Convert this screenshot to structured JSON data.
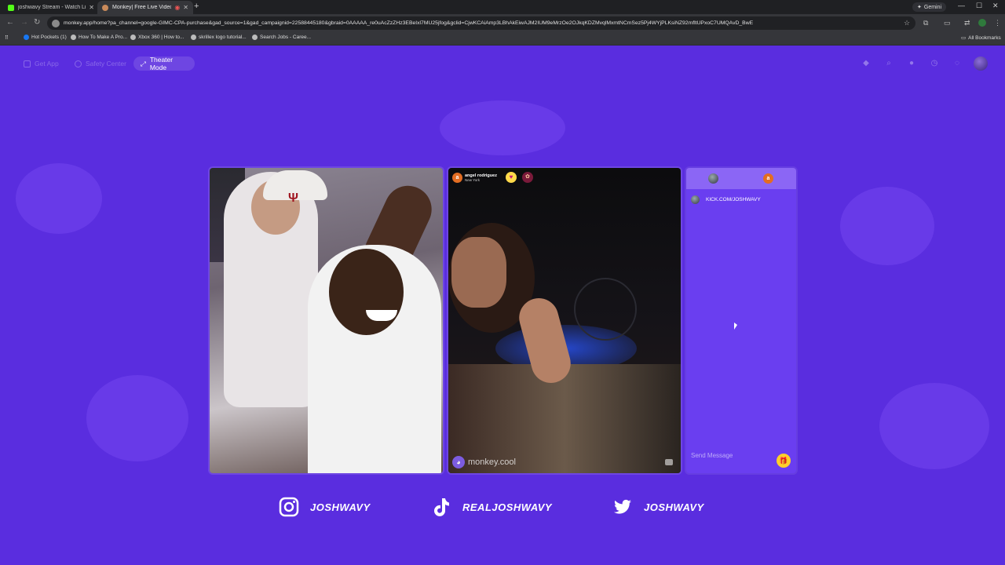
{
  "browser": {
    "tabs": [
      {
        "title": "joshwavy Stream - Watch Live o",
        "favicon_color": "#53fc18",
        "active": false
      },
      {
        "title": "Monkey| Free Live Video Cha",
        "favicon_color": "#c98a5a",
        "active": true
      }
    ],
    "gemini_label": "Gemini",
    "url": "monkey.app/home?pa_channel=google-GIMC-CPA-purchase&gad_source=1&gad_campaignid=22588445180&gbraid=0AAAAA_re0uAcZzZHz3EBeIxl7MU25jfog&gclid=CjwKCAiAmp3LBhAkEiwAJM2IUM9eMrzOe2OJkqKDZMvqlMxmtNCmSez5Pj4WYjPLKsiNZ92mfltUPxoC7UMQAvD_BwE",
    "bookmarks": [
      "Hot Pockets (1)",
      "How To Make A Pro...",
      "Xbox 360 | How to...",
      "skrillex logo tutorial...",
      "Search Jobs - Caree..."
    ],
    "all_bookmarks": "All Bookmarks"
  },
  "nav": {
    "get_app": "Get App",
    "safety_center": "Safety Center",
    "theater_mode": "Theater Mode"
  },
  "stranger": {
    "initial": "a",
    "name": "angel rodriguez",
    "location": "New York"
  },
  "watermark": "monkey.cool",
  "chat": {
    "messages": [
      {
        "text": "KICK.COM/JOSHWAVY"
      }
    ],
    "input_placeholder": "Send Message"
  },
  "socials": [
    {
      "platform": "instagram",
      "handle": "JOSHWAVY"
    },
    {
      "platform": "tiktok",
      "handle": "REALJOSHWAVY"
    },
    {
      "platform": "twitter",
      "handle": "JOSHWAVY"
    }
  ],
  "colors": {
    "page_bg": "#5a2ddf",
    "chat_bg": "#6a3ef0",
    "chat_header": "#8b66f5",
    "gift": "#ffcf2a",
    "avatar_orange": "#e36d22"
  },
  "icons": [
    "back-icon",
    "forward-icon",
    "reload-icon",
    "star-icon",
    "extensions-icon",
    "gem-icon",
    "search-icon",
    "coin-icon",
    "clock-icon",
    "chat-icon",
    "heart-icon",
    "gift-icon",
    "instagram-icon",
    "tiktok-icon",
    "twitter-icon"
  ]
}
